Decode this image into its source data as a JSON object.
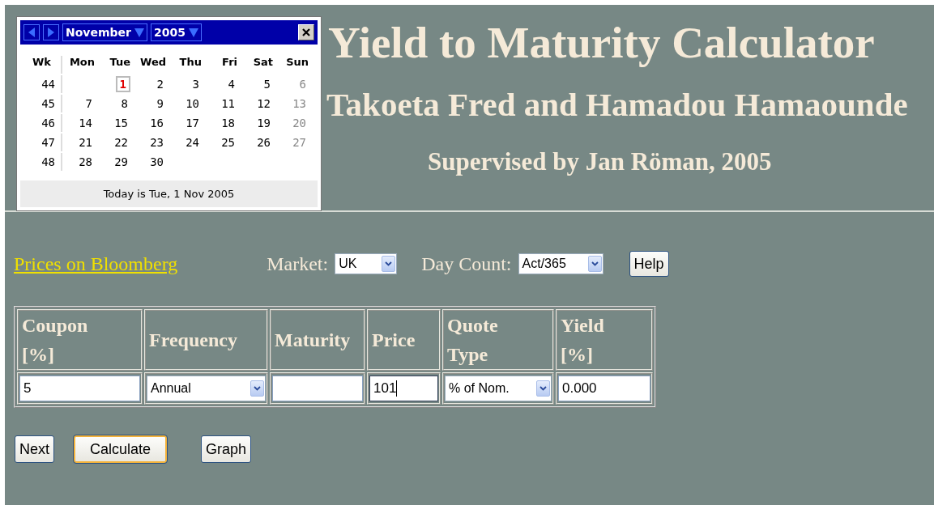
{
  "calendar": {
    "month": "November",
    "year": "2005",
    "week_header": "Wk",
    "day_headers": [
      "Mon",
      "Tue",
      "Wed",
      "Thu",
      "Fri",
      "Sat",
      "Sun"
    ],
    "weeks": [
      {
        "number": "44",
        "days": [
          {
            "kind": "blank"
          },
          {
            "kind": "weekday",
            "text": "1",
            "today": true
          },
          {
            "kind": "weekday",
            "text": "2",
            "today": false
          },
          {
            "kind": "weekday",
            "text": "3",
            "today": false
          },
          {
            "kind": "weekday",
            "text": "4",
            "today": false
          },
          {
            "kind": "weekday",
            "text": "5",
            "today": false
          },
          {
            "kind": "weekend",
            "text": "6",
            "today": false
          }
        ]
      },
      {
        "number": "45",
        "days": [
          {
            "kind": "weekday",
            "text": "7",
            "today": false
          },
          {
            "kind": "weekday",
            "text": "8",
            "today": false
          },
          {
            "kind": "weekday",
            "text": "9",
            "today": false
          },
          {
            "kind": "weekday",
            "text": "10",
            "today": false
          },
          {
            "kind": "weekday",
            "text": "11",
            "today": false
          },
          {
            "kind": "weekday",
            "text": "12",
            "today": false
          },
          {
            "kind": "weekend",
            "text": "13",
            "today": false
          }
        ]
      },
      {
        "number": "46",
        "days": [
          {
            "kind": "weekday",
            "text": "14",
            "today": false
          },
          {
            "kind": "weekday",
            "text": "15",
            "today": false
          },
          {
            "kind": "weekday",
            "text": "16",
            "today": false
          },
          {
            "kind": "weekday",
            "text": "17",
            "today": false
          },
          {
            "kind": "weekday",
            "text": "18",
            "today": false
          },
          {
            "kind": "weekday",
            "text": "19",
            "today": false
          },
          {
            "kind": "weekend",
            "text": "20",
            "today": false
          }
        ]
      },
      {
        "number": "47",
        "days": [
          {
            "kind": "weekday",
            "text": "21",
            "today": false
          },
          {
            "kind": "weekday",
            "text": "22",
            "today": false
          },
          {
            "kind": "weekday",
            "text": "23",
            "today": false
          },
          {
            "kind": "weekday",
            "text": "24",
            "today": false
          },
          {
            "kind": "weekday",
            "text": "25",
            "today": false
          },
          {
            "kind": "weekday",
            "text": "26",
            "today": false
          },
          {
            "kind": "weekend",
            "text": "27",
            "today": false
          }
        ]
      },
      {
        "number": "48",
        "days": [
          {
            "kind": "weekday",
            "text": "28",
            "today": false
          },
          {
            "kind": "weekday",
            "text": "29",
            "today": false
          },
          {
            "kind": "weekday",
            "text": "30",
            "today": false
          },
          {
            "kind": "blank"
          },
          {
            "kind": "blank"
          },
          {
            "kind": "blank"
          },
          {
            "kind": "blank"
          }
        ]
      }
    ],
    "footer": "Today is Tue, 1 Nov 2005"
  },
  "title": "Yield to Maturity Calculator",
  "authors": "Takoeta Fred and Hamadou Hamaounde",
  "supervisor": "Supervised by Jan Röman, 2005",
  "bloomberg_link": "Prices on Bloomberg",
  "market": {
    "label": "Market:",
    "value": "UK"
  },
  "day_count": {
    "label": "Day Count:",
    "value": "Act/365"
  },
  "help_button": "Help",
  "table": {
    "columns": [
      "Coupon\n[%]",
      "Frequency",
      "Maturity",
      "Price",
      "Quote\nType",
      "Yield\n[%]"
    ],
    "row": [
      {
        "kind": "input",
        "value": "5",
        "focused": false
      },
      {
        "kind": "select",
        "value": "Annual"
      },
      {
        "kind": "input",
        "focused": false
      },
      {
        "kind": "input",
        "value": "101",
        "focused": true
      },
      {
        "kind": "select",
        "value": "% of Nom."
      },
      {
        "kind": "input",
        "value": "0.000",
        "focused": false
      }
    ]
  },
  "buttons": [
    {
      "label": "Next",
      "focused": false
    },
    {
      "label": "Calculate",
      "focused": true
    },
    {
      "label": "Graph",
      "focused": false
    }
  ]
}
